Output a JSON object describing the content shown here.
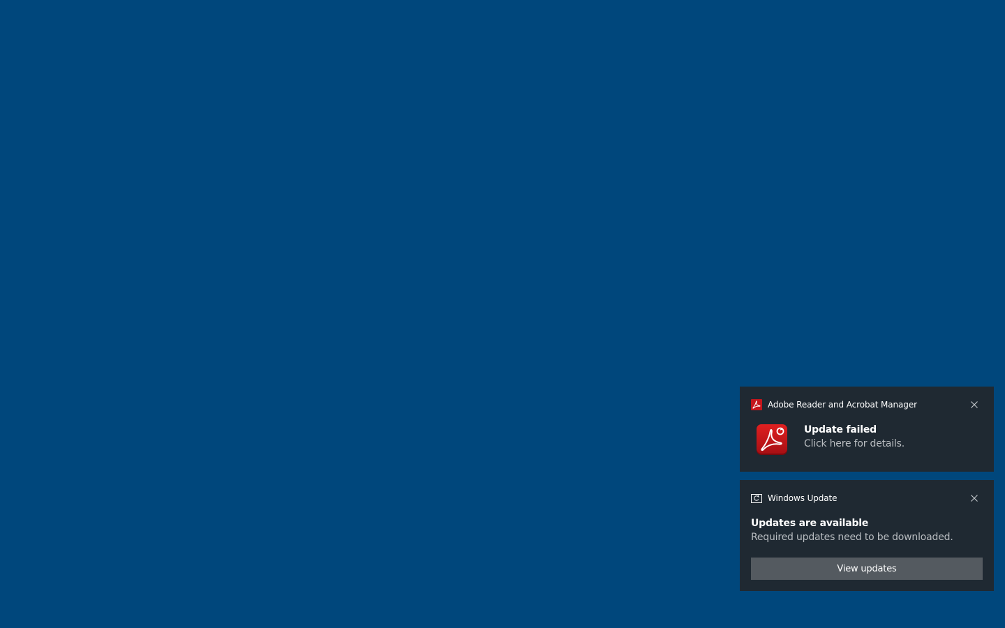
{
  "desktop": {
    "background_color": "#00477c"
  },
  "notifications": [
    {
      "app_name": "Adobe Reader and Acrobat Manager",
      "app_icon": "adobe-acrobat-icon",
      "title": "Update failed",
      "body": "Click here for details.",
      "close_icon": "close-icon"
    },
    {
      "app_name": "Windows Update",
      "app_icon": "windows-update-icon",
      "title": "Updates are available",
      "body": "Required updates need to be downloaded.",
      "action_label": "View updates",
      "close_icon": "close-icon"
    }
  ],
  "colors": {
    "toast_background": "#1f2932",
    "adobe_red": "#c4161c",
    "button_background": "#545a60",
    "secondary_text": "#b9bdc1"
  }
}
